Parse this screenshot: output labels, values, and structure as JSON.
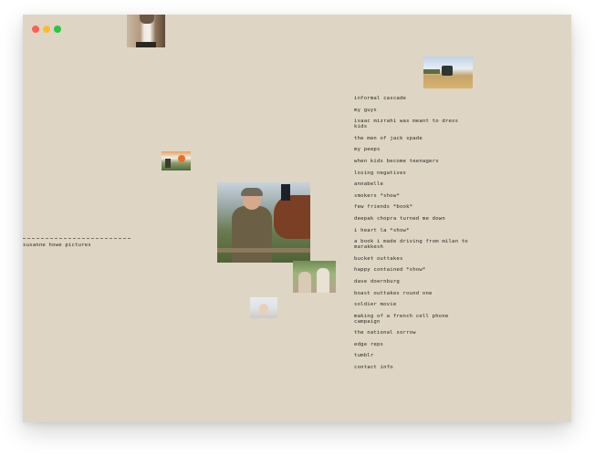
{
  "window": {
    "controls": [
      "close",
      "minimize",
      "maximize"
    ],
    "colors": {
      "background": "#ded5c4",
      "text": "#2c2924"
    }
  },
  "caption": {
    "text": "susanne howe pictures"
  },
  "photos": [
    {
      "name": "man-white-shirt-photo"
    },
    {
      "name": "car-landscape-photo"
    },
    {
      "name": "colorful-small-photo"
    },
    {
      "name": "man-in-cap-with-horse-photo"
    },
    {
      "name": "two-boys-photo"
    },
    {
      "name": "pale-small-photo"
    }
  ],
  "menu": {
    "items": [
      "informal cascade",
      "my guys",
      "isaac mizrahi was meant to dress kids",
      "the men of jack spade",
      "my peeps",
      "when kids become teenagers",
      "losing negatives",
      "annabelle",
      "smokers *show*",
      "few friends *book*",
      "deepak chopra turned me down",
      "i heart la *show*",
      "a book i made driving from milan to marakkesh",
      "bucket outtakes",
      "happy contained *show*",
      "dave doernburg",
      "boast outtakes round one",
      "soldier movie",
      "making of a french cell phone campaign",
      "the national sorrow",
      "edge reps",
      "tumblr",
      "contact info"
    ]
  }
}
